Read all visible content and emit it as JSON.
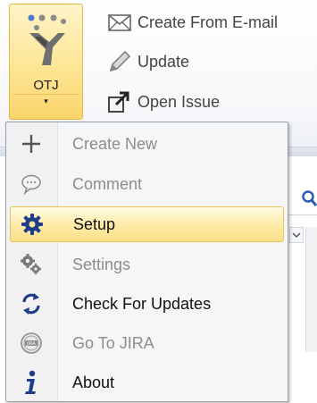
{
  "ribbon": {
    "otj_button": {
      "label": "OTJ",
      "arrow": "▾"
    },
    "buttons": [
      {
        "label": "Create From E-mail",
        "icon": "envelope-icon"
      },
      {
        "label": "Update",
        "icon": "pencil-icon"
      },
      {
        "label": "Open Issue",
        "icon": "open-arrow-icon"
      }
    ]
  },
  "menu": {
    "items": [
      {
        "label": "Create New",
        "icon": "plus-icon",
        "enabled": false
      },
      {
        "label": "Comment",
        "icon": "speech-bubble-icon",
        "enabled": false
      },
      {
        "label": "Setup",
        "icon": "gear-icon",
        "enabled": true,
        "highlighted": true
      },
      {
        "label": "Settings",
        "icon": "gears-icon",
        "enabled": false
      },
      {
        "label": "Check For Updates",
        "icon": "refresh-icon",
        "enabled": true
      },
      {
        "label": "Go To JIRA",
        "icon": "jira-icon",
        "enabled": false
      },
      {
        "label": "About",
        "icon": "info-icon",
        "enabled": true
      }
    ]
  },
  "colors": {
    "highlight_border": "#e7c35d",
    "highlight_fill": "#fde8a0",
    "disabled_text": "#8d8d8d",
    "enabled_text": "#111111",
    "setup_icon": "#1f3d8a",
    "updates_icon": "#1f3d8a"
  }
}
